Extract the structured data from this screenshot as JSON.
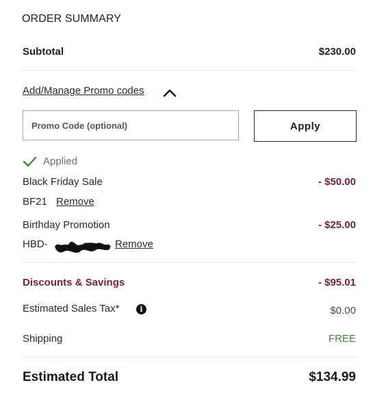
{
  "summary": {
    "title": "ORDER SUMMARY",
    "subtotal_label": "Subtotal",
    "subtotal_value": "$230.00"
  },
  "promo": {
    "link_label": "Add/Manage Promo codes",
    "chevron_icon": "chevron-up-icon",
    "input_placeholder": "Promo Code (optional)",
    "input_value": "",
    "apply_label": "Apply",
    "applied_icon": "check-icon",
    "applied_label": "Applied",
    "applied_codes": [
      {
        "name": "Black Friday Sale",
        "amount": "- $50.00",
        "code": "BF21",
        "remove_label": "Remove"
      },
      {
        "name": "Birthday Promotion",
        "amount": "- $25.00",
        "code": "HBD-",
        "remove_label": "Remove"
      }
    ]
  },
  "totals": {
    "discounts_label": "Discounts & Savings",
    "discounts_value": "- $95.01",
    "tax_label": "Estimated Sales Tax*",
    "tax_info_icon": "info-icon",
    "tax_value": "$0.00",
    "shipping_label": "Shipping",
    "shipping_value": "FREE",
    "total_label": "Estimated Total",
    "total_value": "$134.99"
  },
  "colors": {
    "discount_accent": "#7a1f3b",
    "free_shipping": "#3d8a33",
    "applied_check": "#3d8a33"
  }
}
